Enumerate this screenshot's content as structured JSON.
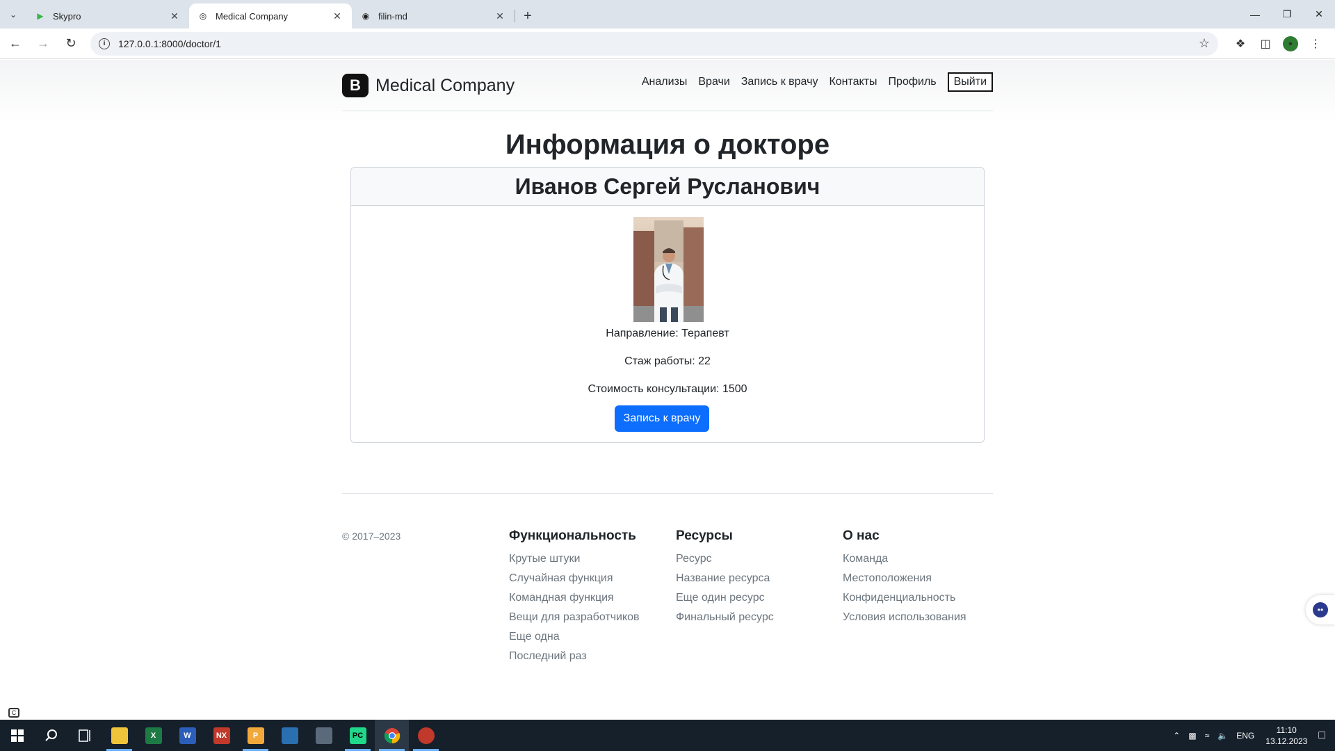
{
  "browser": {
    "tabs": [
      {
        "title": "Skypro",
        "icon": "skypro-play-icon",
        "active": false
      },
      {
        "title": "Medical Company",
        "icon": "globe-icon",
        "active": true
      },
      {
        "title": "filin-md",
        "icon": "github-icon",
        "active": false
      }
    ],
    "url": "127.0.0.1:8000/doctor/1"
  },
  "site": {
    "brand_letter": "B",
    "brand": "Medical Company",
    "nav": [
      "Анализы",
      "Врачи",
      "Запись к врачу",
      "Контакты",
      "Профиль"
    ],
    "logout": "Выйти"
  },
  "main": {
    "title": "Информация о докторе",
    "doctor": {
      "name": "Иванов Сергей Русланович",
      "direction": "Направление: Терапевт",
      "experience": "Стаж работы: 22",
      "price": "Стоимость консультации: 1500",
      "book_button": "Запись к врачу"
    }
  },
  "footer": {
    "copyright": "© 2017–2023",
    "columns": [
      {
        "title": "Функциональность",
        "items": [
          "Крутые штуки",
          "Случайная функция",
          "Командная функция",
          "Вещи для разработчиков",
          "Еще одна",
          "Последний раз"
        ]
      },
      {
        "title": "Ресурсы",
        "items": [
          "Ресурс",
          "Название ресурса",
          "Еще один ресурс",
          "Финальный ресурс"
        ]
      },
      {
        "title": "О нас",
        "items": [
          "Команда",
          "Местоположения",
          "Конфиденциальность",
          "Условия использования"
        ]
      }
    ]
  },
  "taskbar": {
    "lang": "ENG",
    "time": "11:10",
    "date": "13.12.2023",
    "apps": [
      {
        "icon": "file-explorer-icon",
        "label": "",
        "color": "#f0c43a"
      },
      {
        "icon": "excel-icon",
        "label": "X",
        "color": "#1d7a45"
      },
      {
        "icon": "word-icon",
        "label": "W",
        "color": "#2b5eb8"
      },
      {
        "icon": "nx-icon",
        "label": "NX",
        "color": "#c0392b"
      },
      {
        "icon": "powerpoint-icon",
        "label": "P",
        "color": "#f2a93b"
      },
      {
        "icon": "network-app-icon",
        "label": "",
        "color": "#2a6fb0"
      },
      {
        "icon": "calculator-icon",
        "label": "",
        "color": "#5a6a7a"
      },
      {
        "icon": "pycharm-icon",
        "label": "PC",
        "color": "#21d789"
      },
      {
        "icon": "chrome-icon",
        "label": "",
        "color": "#e9a33a"
      },
      {
        "icon": "pinned-app-icon",
        "label": "",
        "color": "#c0392b"
      }
    ]
  }
}
